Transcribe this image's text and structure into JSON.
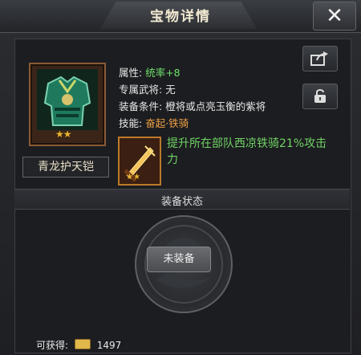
{
  "window": {
    "title": "宝物详情",
    "close_icon": "close-icon"
  },
  "item": {
    "name": "青龙护天铠",
    "stars": "★★",
    "attribute_label": "属性:",
    "attribute_value": "统率+8",
    "exclusive_general_label": "专属武将:",
    "exclusive_general_value": "无",
    "equip_condition_label": "装备条件:",
    "equip_condition_value": "橙将或点亮玉衡的紫将",
    "skill_label": "技能:",
    "skill_value": "奋起·铁骑",
    "skill_description": "提升所在部队西凉铁骑21%攻击力",
    "skill_stars": "★★"
  },
  "side_buttons": {
    "share_icon": "share-icon",
    "lock_icon": "lock-icon"
  },
  "equip_section": {
    "title": "装备状态",
    "status": "未装备"
  },
  "footer": {
    "obtain_label": "可获得:",
    "currency_icon": "gold-icon",
    "amount": "1497"
  },
  "colors": {
    "green": "#6fe06c",
    "orange": "#f0a145",
    "gold": "#e8b42f"
  }
}
